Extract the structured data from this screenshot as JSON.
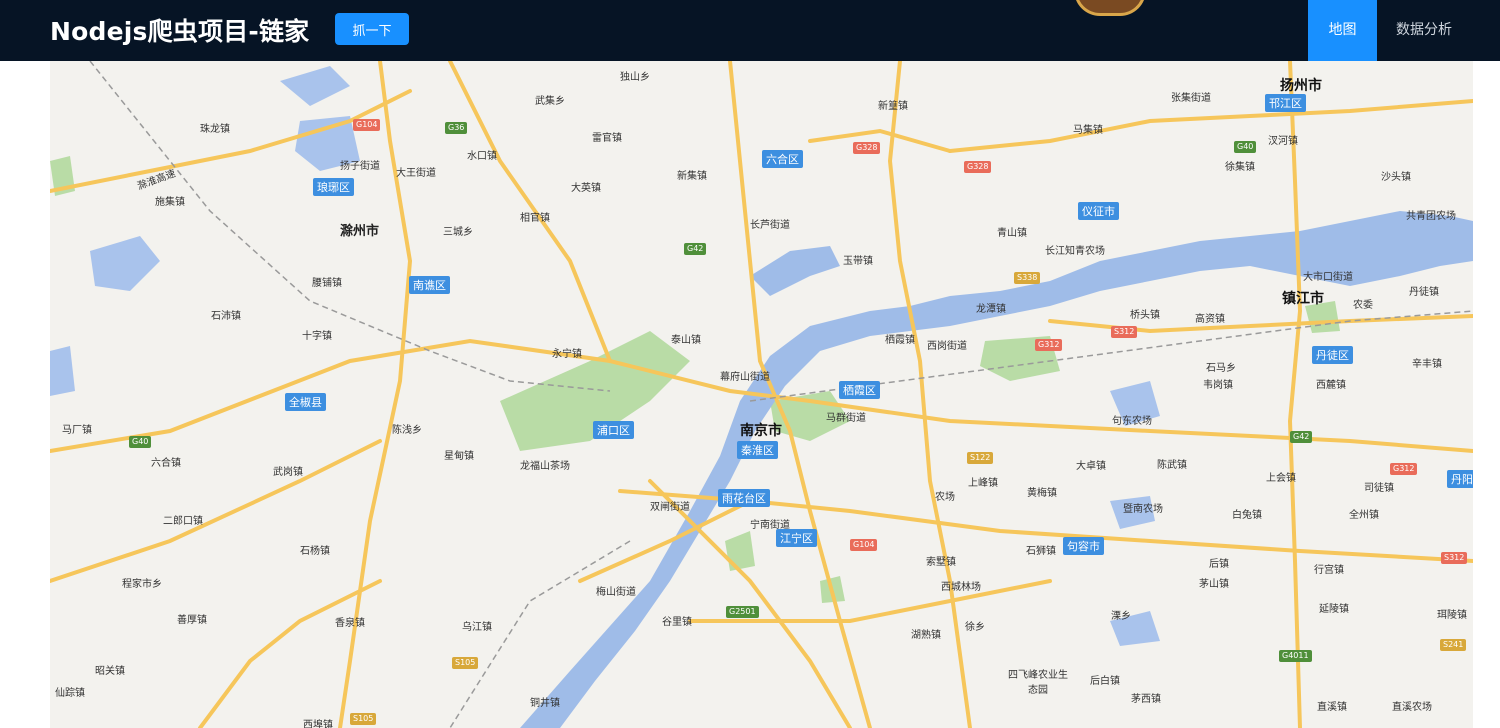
{
  "header": {
    "title": "Nodejs爬虫项目-链家",
    "crawl_button": "抓一下",
    "nav": [
      "地图",
      "数据分析"
    ]
  },
  "colors": {
    "header_bg": "#061425",
    "accent": "#1890ff",
    "river": "#9fbce8",
    "road": "#f6c65b",
    "park": "#b9dca6"
  },
  "map": {
    "cities": [
      "扬州市",
      "滁州市",
      "南京市",
      "镇江市"
    ],
    "districts": [
      "邗江区",
      "六合区",
      "琅琊区",
      "仪征市",
      "南谯区",
      "栖霞区",
      "全椒县",
      "浦口区",
      "秦淮区",
      "丹徒区",
      "雨花台区",
      "江宁区",
      "句容市",
      "丹阳"
    ],
    "places": [
      "独山乡",
      "武集乡",
      "珠龙镇",
      "雷官镇",
      "水口镇",
      "扬子街道",
      "大王街道",
      "新集镇",
      "大英镇",
      "施集镇",
      "相官镇",
      "三城乡",
      "长芦街道",
      "玉带镇",
      "新篁镇",
      "马集镇",
      "张集街道",
      "汊河镇",
      "徐集镇",
      "沙头镇",
      "青山镇",
      "长江知青农场",
      "共青团农场",
      "大市口街道",
      "丹徒镇",
      "腰铺镇",
      "石沛镇",
      "十字镇",
      "永宁镇",
      "泰山镇",
      "龙潭镇",
      "桥头镇",
      "高资镇",
      "农委",
      "栖霞镇",
      "西岗街道",
      "石马乡",
      "韦岗镇",
      "西麓镇",
      "辛丰镇",
      "幕府山街道",
      "马群街道",
      "句东农场",
      "马厂镇",
      "陈浅乡",
      "六合镇",
      "星甸镇",
      "龙福山茶场",
      "武岗镇",
      "大卓镇",
      "陈武镇",
      "上会镇",
      "司徒镇",
      "二郎口镇",
      "双闸街道",
      "农场",
      "上峰镇",
      "黄梅镇",
      "暨南农场",
      "白兔镇",
      "全州镇",
      "宁南街道",
      "石杨镇",
      "索墅镇",
      "石狮镇",
      "后镇",
      "行宫镇",
      "程家市乡",
      "梅山街道",
      "西城林场",
      "茅山镇",
      "善厚镇",
      "香泉镇",
      "乌江镇",
      "谷里镇",
      "徐乡",
      "延陵镇",
      "珥陵镇",
      "湖熟镇",
      "溧乡",
      "昭关镇",
      "四飞峰农业生态园",
      "后白镇",
      "仙踪镇",
      "铜井镇",
      "茅西镇",
      "直溪镇",
      "直溪农场",
      "西埠镇",
      "滁淮高速"
    ],
    "road_codes": [
      "G104",
      "G36",
      "G328",
      "G328",
      "G40",
      "G42",
      "S338",
      "S312",
      "G312",
      "G312",
      "G40",
      "G42",
      "S122",
      "G104",
      "S312",
      "G2501",
      "S105",
      "S105",
      "S241",
      "G4011"
    ]
  }
}
